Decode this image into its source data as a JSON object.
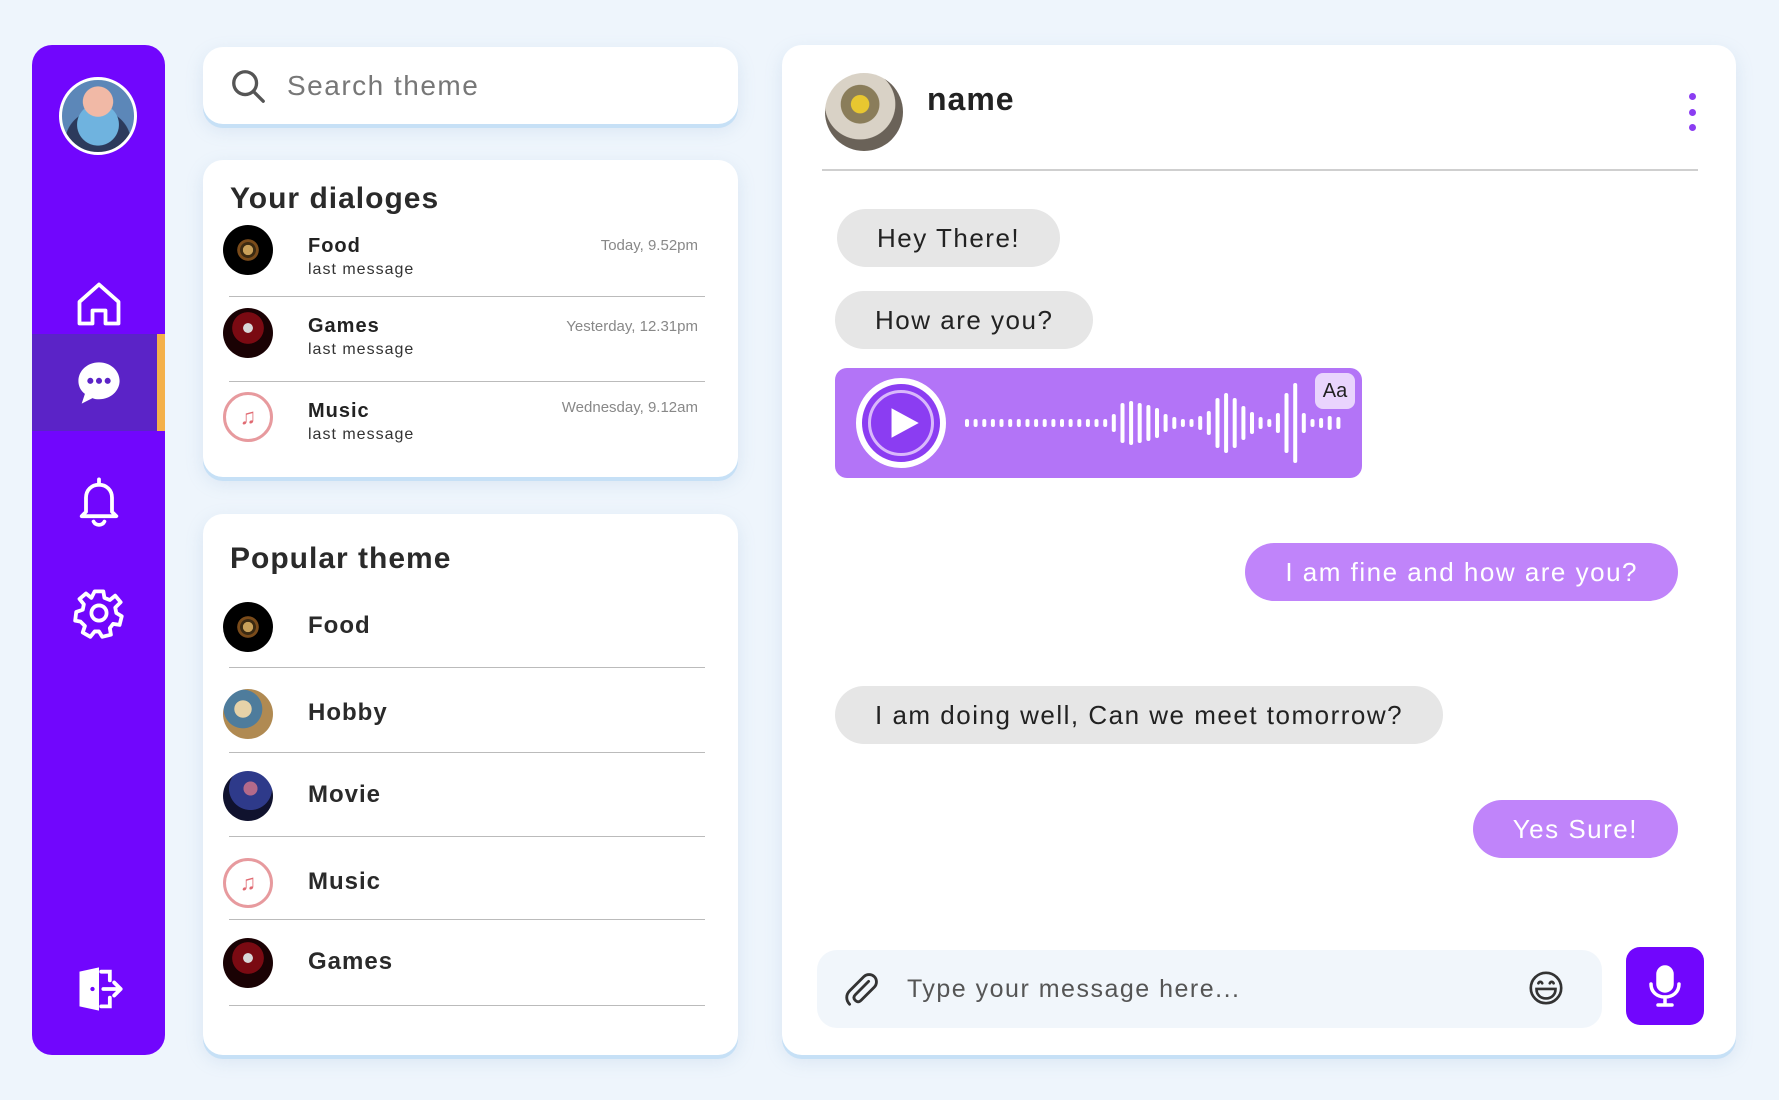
{
  "sidebar": {
    "items": [
      {
        "name": "home",
        "icon": "home-icon",
        "active": false
      },
      {
        "name": "messages",
        "icon": "chat-bubble-icon",
        "active": true
      },
      {
        "name": "notifications",
        "icon": "bell-icon",
        "active": false
      },
      {
        "name": "settings",
        "icon": "gear-icon",
        "active": false
      }
    ],
    "logout_icon": "logout-icon",
    "colors": {
      "background": "#7106fd",
      "active": "#5b23c7",
      "active_marker": "#f4b04a"
    }
  },
  "search": {
    "placeholder": "Search theme"
  },
  "dialogs": {
    "title": "Your dialoges",
    "items": [
      {
        "name": "Food",
        "last_message": "last message",
        "time": "Today, 9.52pm"
      },
      {
        "name": "Games",
        "last_message": "last message",
        "time": "Yesterday, 12.31pm"
      },
      {
        "name": "Music",
        "last_message": "last message",
        "time": "Wednesday, 9.12am"
      }
    ]
  },
  "popular": {
    "title": "Popular theme",
    "items": [
      {
        "name": "Food"
      },
      {
        "name": "Hobby"
      },
      {
        "name": "Movie"
      },
      {
        "name": "Music"
      },
      {
        "name": "Games"
      }
    ]
  },
  "chat": {
    "contact_name": "name",
    "messages": [
      {
        "direction": "in",
        "text": "Hey There!"
      },
      {
        "direction": "in",
        "text": "How are you?"
      },
      {
        "direction": "in",
        "type": "voice",
        "badge": "Aa"
      },
      {
        "direction": "out",
        "text": "I am fine and how are you?"
      },
      {
        "direction": "in",
        "text": "I am doing well, Can we meet tomorrow?"
      },
      {
        "direction": "out",
        "text": "Yes Sure!"
      }
    ],
    "composer": {
      "placeholder": "Type your message here..."
    },
    "colors": {
      "incoming": "#e6e6e6",
      "outgoing": "#c084fa",
      "voice": "#b374f7",
      "accent": "#7106fd"
    }
  }
}
